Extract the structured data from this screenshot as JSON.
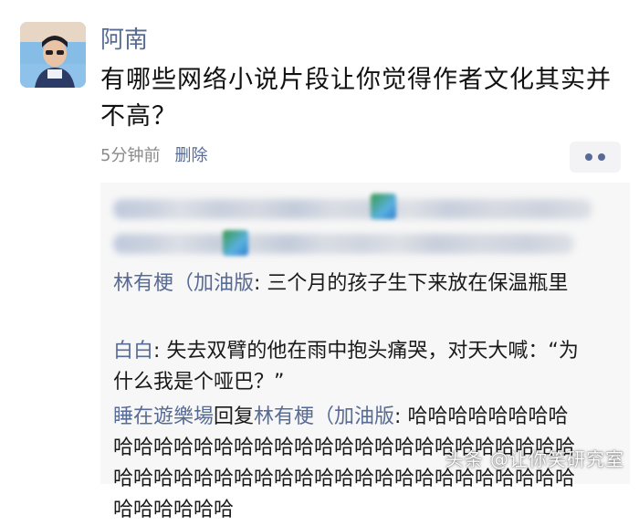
{
  "post": {
    "author": "阿南",
    "text": "有哪些网络小说片段让你觉得作者文化其实并不高？",
    "time": "5分钟前",
    "delete_label": "删除",
    "more_icon": "more-dots-icon"
  },
  "comments": [
    {
      "name": "林有梗（加油版",
      "separator": ": ",
      "text": "三个月的孩子生下来放在保温瓶里"
    },
    {
      "name": "白白",
      "separator": ": ",
      "text": "失去双臂的他在雨中抱头痛哭，对天大喊：“为什么我是个哑巴？”"
    },
    {
      "name": "睡在遊樂場",
      "reply_word": "回复",
      "reply_to": "林有梗（加油版",
      "separator": ": ",
      "text": "哈哈哈哈哈哈哈哈哈哈哈哈哈哈哈哈哈哈哈哈哈哈哈哈哈哈哈哈哈哈哈哈哈哈哈哈哈哈哈哈哈哈哈哈哈哈哈哈哈哈哈哈哈哈哈哈哈哈哈哈"
    }
  ],
  "watermark": "头条 @让你笑研究室",
  "colors": {
    "link": "#576b95",
    "meta": "#8a8a8a",
    "comment_bg": "#f7f7f7"
  }
}
